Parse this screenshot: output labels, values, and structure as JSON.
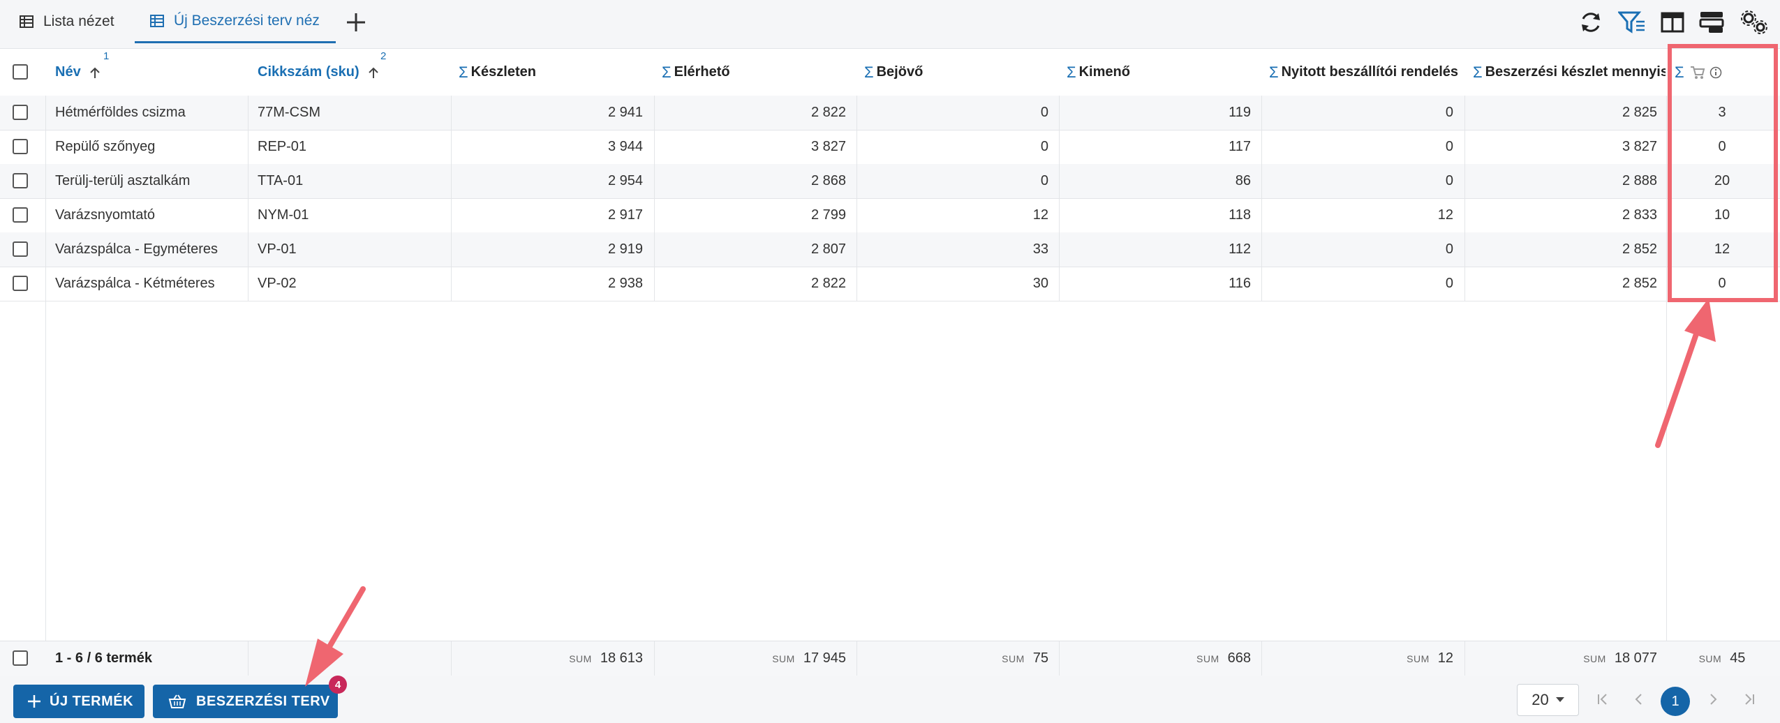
{
  "tabs": [
    {
      "label": "Lista nézet",
      "active": false
    },
    {
      "label": "Új Beszerzési terv néz",
      "active": true
    }
  ],
  "toolbar_icons": [
    "refresh-icon",
    "filter-icon",
    "columns-icon",
    "layout-icon",
    "settings-icon"
  ],
  "columns": [
    {
      "label": "Név",
      "sort_order": "1"
    },
    {
      "label": "Cikkszám (sku)",
      "sort_order": "2"
    },
    {
      "label": "Készleten"
    },
    {
      "label": "Elérhető"
    },
    {
      "label": "Bejövő"
    },
    {
      "label": "Kimenő"
    },
    {
      "label": "Nyitott beszállítói rendelés"
    },
    {
      "label": "Beszerzési készlet mennyis"
    },
    {
      "label": ""
    }
  ],
  "rows": [
    [
      "Hétmérföldes csizma",
      "77M-CSM",
      "2 941",
      "2 822",
      "0",
      "119",
      "0",
      "2 825",
      "3"
    ],
    [
      "Repülő szőnyeg",
      "REP-01",
      "3 944",
      "3 827",
      "0",
      "117",
      "0",
      "3 827",
      "0"
    ],
    [
      "Terülj-terülj asztalkám",
      "TTA-01",
      "2 954",
      "2 868",
      "0",
      "86",
      "0",
      "2 888",
      "20"
    ],
    [
      "Varázsnyomtató",
      "NYM-01",
      "2 917",
      "2 799",
      "12",
      "118",
      "12",
      "2 833",
      "10"
    ],
    [
      "Varázspálca - Egyméteres",
      "VP-01",
      "2 919",
      "2 807",
      "33",
      "112",
      "0",
      "2 852",
      "12"
    ],
    [
      "Varázspálca - Kétméteres",
      "VP-02",
      "2 938",
      "2 822",
      "30",
      "116",
      "0",
      "2 852",
      "0"
    ]
  ],
  "footer": {
    "count_label": "1 - 6 / 6 termék",
    "sum_label": "SUM",
    "sums": [
      "18 613",
      "17 945",
      "75",
      "668",
      "12",
      "18 077",
      "45"
    ]
  },
  "buttons": {
    "new_product": "ÚJ TERMÉK",
    "procurement_plan": "BESZERZÉSI TERV",
    "procurement_badge": "4"
  },
  "pagination": {
    "page_size": "20",
    "current_page": "1"
  },
  "colors": {
    "accent": "#1565a8",
    "highlight": "#ef6670",
    "badge": "#c8285a"
  }
}
